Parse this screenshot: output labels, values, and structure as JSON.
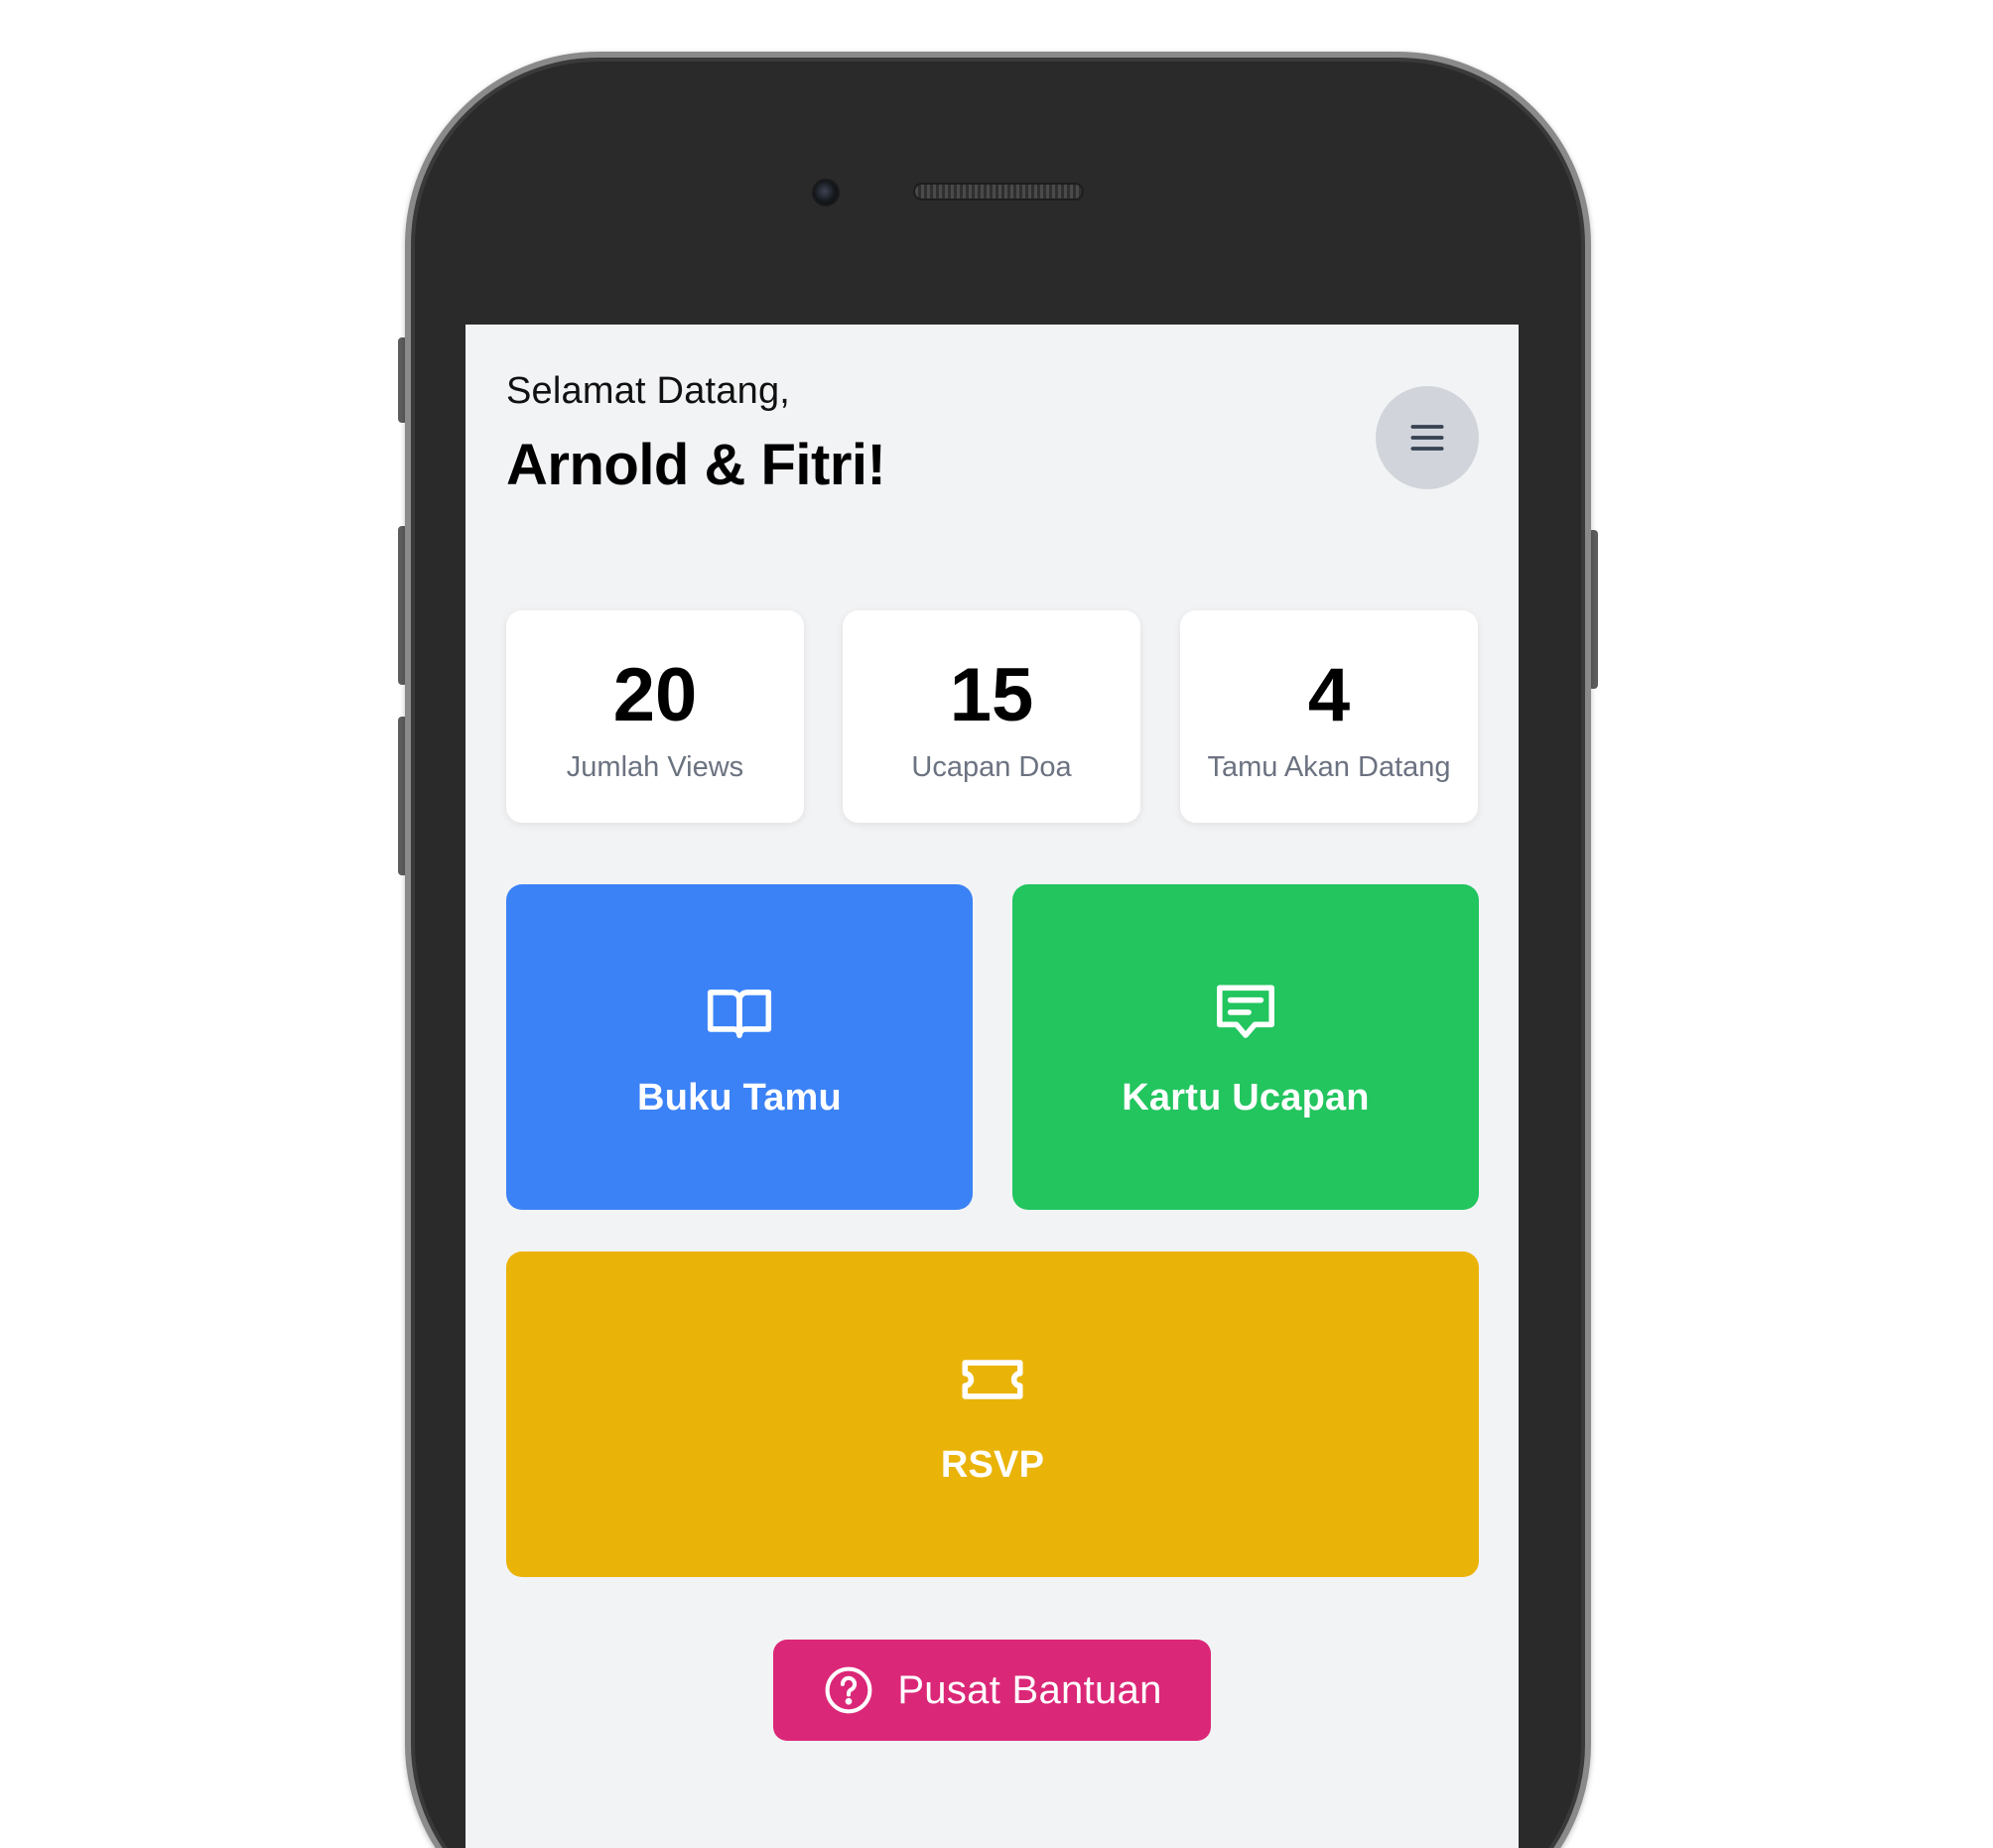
{
  "header": {
    "greeting": "Selamat Datang,",
    "couple_name": "Arnold & Fitri!",
    "menu_icon": "hamburger-menu-icon"
  },
  "stats": [
    {
      "value": "20",
      "label": "Jumlah Views"
    },
    {
      "value": "15",
      "label": "Ucapan Doa"
    },
    {
      "value": "4",
      "label": "Tamu Akan Datang"
    }
  ],
  "actions": {
    "guestbook": {
      "label": "Buku Tamu",
      "icon": "open-book-icon",
      "color": "#3b82f6"
    },
    "greeting_card": {
      "label": "Kartu Ucapan",
      "icon": "chat-message-icon",
      "color": "#22c55e"
    },
    "rsvp": {
      "label": "RSVP",
      "icon": "ticket-icon",
      "color": "#eab308"
    }
  },
  "help": {
    "label": "Pusat Bantuan",
    "icon": "question-circle-icon",
    "color": "#db2777"
  }
}
